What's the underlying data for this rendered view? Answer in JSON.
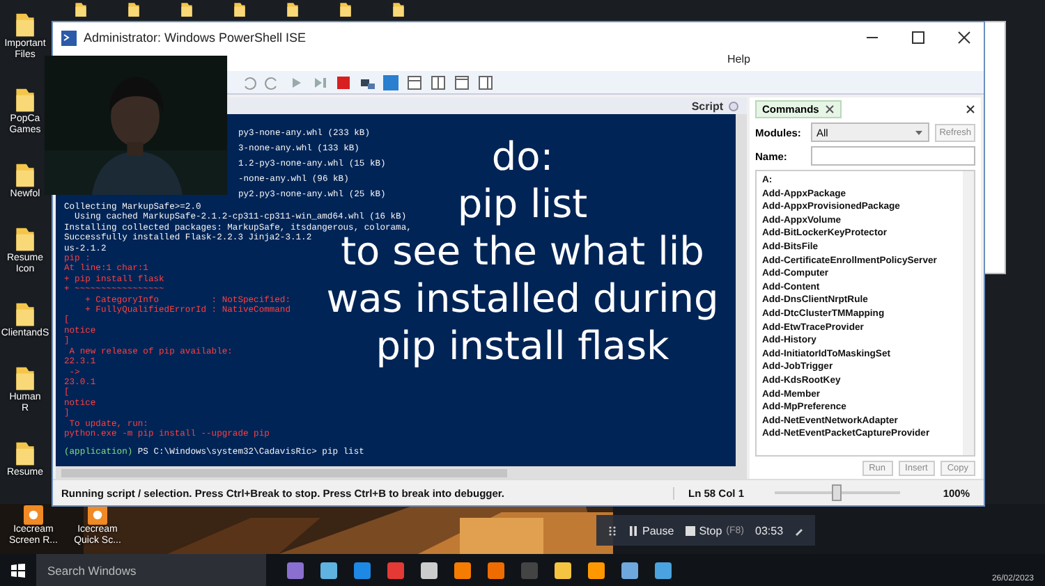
{
  "desktop_icons": [
    {
      "label": "Important Files"
    },
    {
      "label": "PopCa Games"
    },
    {
      "label": "Newfol"
    },
    {
      "label": "Resume Icon"
    },
    {
      "label": "ClientandS"
    },
    {
      "label": "Human R"
    },
    {
      "label": "Resume"
    }
  ],
  "desktop_icons_bottom": [
    {
      "label": "Icecream Screen R..."
    },
    {
      "label": "Icecream Quick Sc..."
    }
  ],
  "window": {
    "title": "Administrator: Windows PowerShell ISE",
    "menu": [
      "Help"
    ],
    "pane_title": "Script"
  },
  "console": [
    {
      "kind": "cut",
      "text": "py3-none-any.whl (233 kB)"
    },
    {
      "kind": "cut",
      "text": "3-none-any.whl (133 kB)"
    },
    {
      "kind": "cut",
      "text": "1.2-py3-none-any.whl (15 kB)"
    },
    {
      "kind": "cut",
      "text": "-none-any.whl (96 kB)"
    },
    {
      "kind": "cut",
      "text": "py2.py3-none-any.whl (25 kB)"
    },
    {
      "kind": "output",
      "text": "Collecting MarkupSafe>=2.0"
    },
    {
      "kind": "output",
      "text": "  Using cached MarkupSafe-2.1.2-cp311-cp311-win_amd64.whl (16 kB)"
    },
    {
      "kind": "output",
      "text": "Installing collected packages: MarkupSafe, itsdangerous, colorama,"
    },
    {
      "kind": "output",
      "text": "Successfully installed Flask-2.2.3 Jinja2-3.1.2"
    },
    {
      "kind": "output",
      "text": "us-2.1.2"
    },
    {
      "kind": "error",
      "text": "pip :"
    },
    {
      "kind": "error",
      "text": "At line:1 char:1"
    },
    {
      "kind": "error",
      "text": "+ pip install flask"
    },
    {
      "kind": "error",
      "text": "+ ~~~~~~~~~~~~~~~~~"
    },
    {
      "kind": "error",
      "text": "    + CategoryInfo          : NotSpecified:"
    },
    {
      "kind": "error",
      "text": "    + FullyQualifiedErrorId : NativeCommand"
    },
    {
      "kind": "error",
      "text": "["
    },
    {
      "kind": "error",
      "text": "notice"
    },
    {
      "kind": "error",
      "text": "]"
    },
    {
      "kind": "error",
      "text": " A new release of pip available:"
    },
    {
      "kind": "error",
      "text": "22.3.1"
    },
    {
      "kind": "error",
      "text": " -> "
    },
    {
      "kind": "error",
      "text": "23.0.1"
    },
    {
      "kind": "error",
      "text": "["
    },
    {
      "kind": "error",
      "text": "notice"
    },
    {
      "kind": "error",
      "text": "]"
    },
    {
      "kind": "error",
      "text": " To update, run:"
    },
    {
      "kind": "error",
      "text": "python.exe -m pip install --upgrade pip"
    }
  ],
  "prompt": {
    "env": "(application)",
    "text": "PS C:\\Windows\\system32\\CadavisRic> pip list"
  },
  "caption": [
    "do:",
    "pip list",
    "to see the what lib",
    "was installed during",
    "pip install flask"
  ],
  "commands": {
    "tab": "Commands",
    "modules_label": "Modules:",
    "modules_value": "All",
    "refresh": "Refresh",
    "name_label": "Name:",
    "items": [
      "A:",
      "Add-AppxPackage",
      "Add-AppxProvisionedPackage",
      "Add-AppxVolume",
      "Add-BitLockerKeyProtector",
      "Add-BitsFile",
      "Add-CertificateEnrollmentPolicyServer",
      "Add-Computer",
      "Add-Content",
      "Add-DnsClientNrptRule",
      "Add-DtcClusterTMMapping",
      "Add-EtwTraceProvider",
      "Add-History",
      "Add-InitiatorIdToMaskingSet",
      "Add-JobTrigger",
      "Add-KdsRootKey",
      "Add-Member",
      "Add-MpPreference",
      "Add-NetEventNetworkAdapter",
      "Add-NetEventPacketCaptureProvider"
    ],
    "buttons": [
      "Run",
      "Insert",
      "Copy"
    ]
  },
  "status_bar": {
    "message": "Running script / selection.  Press Ctrl+Break to stop.  Press Ctrl+B to break into debugger.",
    "position": "Ln 58  Col 1",
    "zoom": "100%",
    "level": 0.45
  },
  "recorder": {
    "pause": "Pause",
    "stop": "Stop",
    "stop_key": "(F8)",
    "time": "03:53"
  },
  "taskbar": {
    "search": "Search Windows",
    "date": "26/02/2023"
  }
}
